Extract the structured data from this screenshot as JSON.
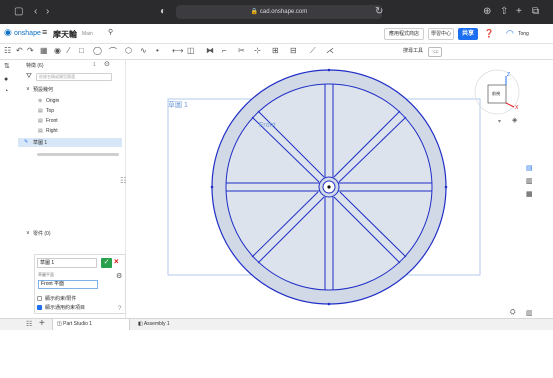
{
  "browser": {
    "url": "cad.onshape.com"
  },
  "header": {
    "logo": "onshape",
    "doc_title": "摩天輪",
    "workspace": "Main",
    "app_store": "應用程式商店",
    "learn": "學習中心",
    "share": "共享",
    "user": "Tong"
  },
  "toolbar": {
    "search_tools": "搜尋工具",
    "shortcut": "⌥C"
  },
  "features": {
    "title": "特徵 (6)",
    "count": "1",
    "filter_placeholder": "依據名稱或類型篩選",
    "default_geometry": "預設幾何",
    "items": [
      "Origin",
      "Top",
      "Front",
      "Right"
    ],
    "sketch": "草圖 1",
    "parts": "零件 (0)"
  },
  "dialog": {
    "name": "草圖 1",
    "plane_label": "草圖平面",
    "plane_value": "Front 平面",
    "option1": "顯示約束/限件",
    "option2": "顯示通用約束項目"
  },
  "canvas": {
    "sketch_label": "草圖 1",
    "plane_label": "Front"
  },
  "view_cube": {
    "face": "前視",
    "axis_x": "X",
    "axis_z": "Z"
  },
  "tabs": {
    "part_studio": "Part Studio 1",
    "assembly": "Assembly 1"
  },
  "colors": {
    "accent": "#1d6ff2",
    "sketch_fill": "#d2d9e6",
    "sketch_stroke": "#1f2ec7",
    "ok": "#2aa14a"
  }
}
